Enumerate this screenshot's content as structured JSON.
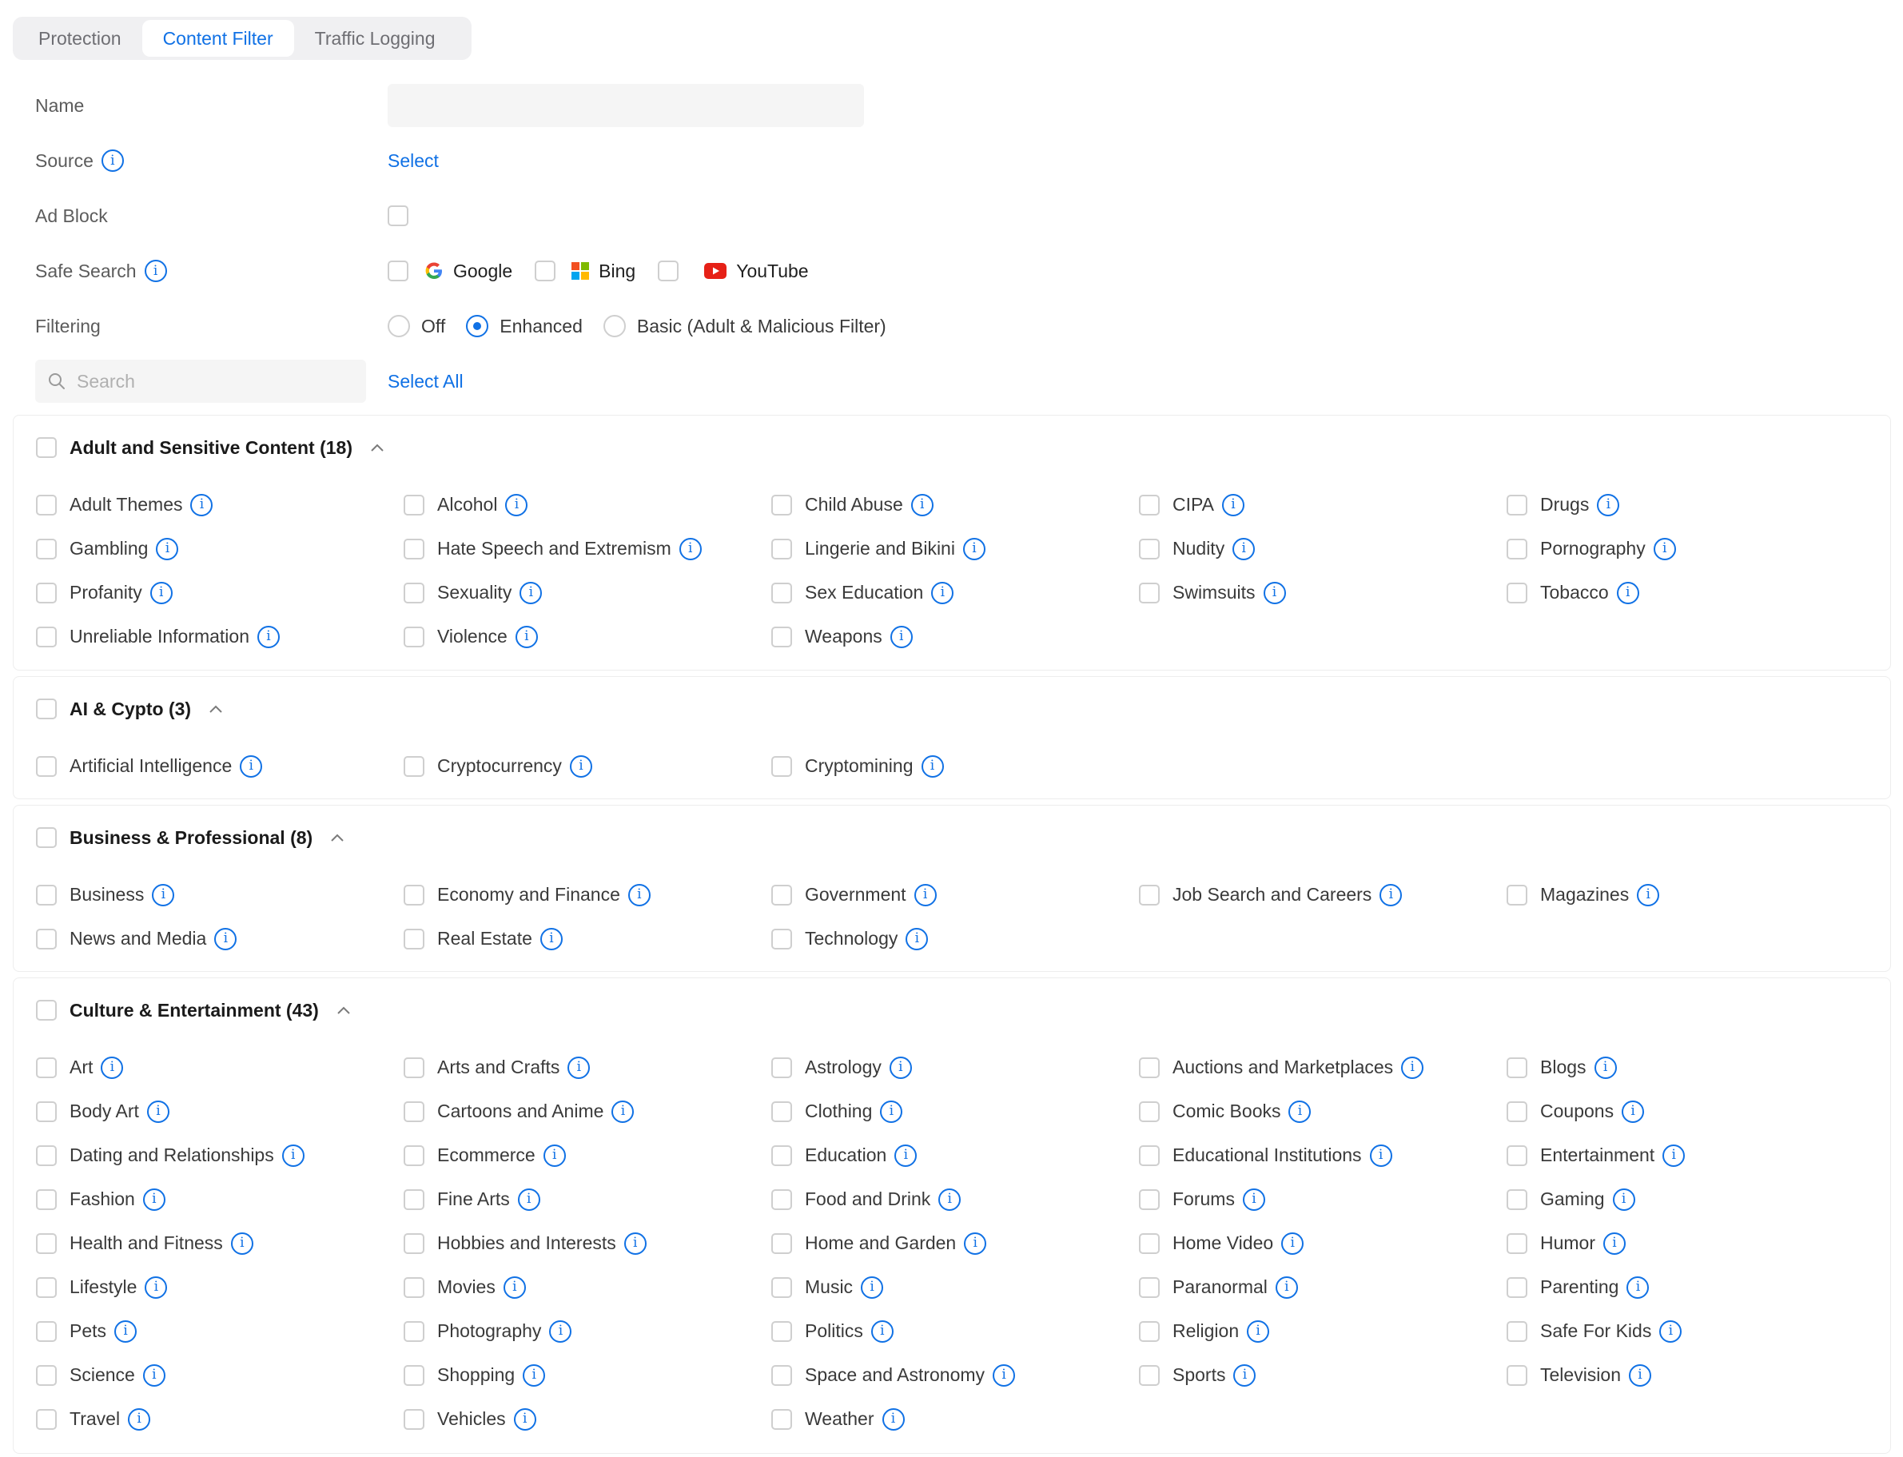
{
  "tabs": [
    "Protection",
    "Content Filter",
    "Traffic Logging"
  ],
  "form": {
    "name_label": "Name",
    "name_value": "",
    "source_label": "Source",
    "source_action": "Select",
    "adblock_label": "Ad Block",
    "safesearch_label": "Safe Search",
    "safesearch_options": [
      "Google",
      "Bing",
      "YouTube"
    ],
    "filtering_label": "Filtering",
    "filtering_options": [
      "Off",
      "Enhanced",
      "Basic (Adult & Malicious Filter)"
    ],
    "filtering_selected": "Enhanced",
    "search_placeholder": "Search",
    "select_all": "Select All"
  },
  "colors": {
    "accent": "#1071e5"
  },
  "sections": [
    {
      "title": "Adult and Sensitive Content (18)",
      "items": [
        "Adult Themes",
        "Alcohol",
        "Child Abuse",
        "CIPA",
        "Drugs",
        "Gambling",
        "Hate Speech and Extremism",
        "Lingerie and Bikini",
        "Nudity",
        "Pornography",
        "Profanity",
        "Sexuality",
        "Sex Education",
        "Swimsuits",
        "Tobacco",
        "Unreliable Information",
        "Violence",
        "Weapons"
      ]
    },
    {
      "title": "AI & Cypto (3)",
      "items": [
        "Artificial Intelligence",
        "Cryptocurrency",
        "Cryptomining"
      ]
    },
    {
      "title": "Business & Professional (8)",
      "items": [
        "Business",
        "Economy and Finance",
        "Government",
        "Job Search and Careers",
        "Magazines",
        "News and Media",
        "Real Estate",
        "Technology"
      ]
    },
    {
      "title": "Culture & Entertainment (43)",
      "items": [
        "Art",
        "Arts and Crafts",
        "Astrology",
        "Auctions and Marketplaces",
        "Blogs",
        "Body Art",
        "Cartoons and Anime",
        "Clothing",
        "Comic Books",
        "Coupons",
        "Dating and Relationships",
        "Ecommerce",
        "Education",
        "Educational Institutions",
        "Entertainment",
        "Fashion",
        "Fine Arts",
        "Food and Drink",
        "Forums",
        "Gaming",
        "Health and Fitness",
        "Hobbies and Interests",
        "Home and Garden",
        "Home Video",
        "Humor",
        "Lifestyle",
        "Movies",
        "Music",
        "Paranormal",
        "Parenting",
        "Pets",
        "Photography",
        "Politics",
        "Religion",
        "Safe For Kids",
        "Science",
        "Shopping",
        "Space and Astronomy",
        "Sports",
        "Television",
        "Travel",
        "Vehicles",
        "Weather"
      ]
    }
  ]
}
